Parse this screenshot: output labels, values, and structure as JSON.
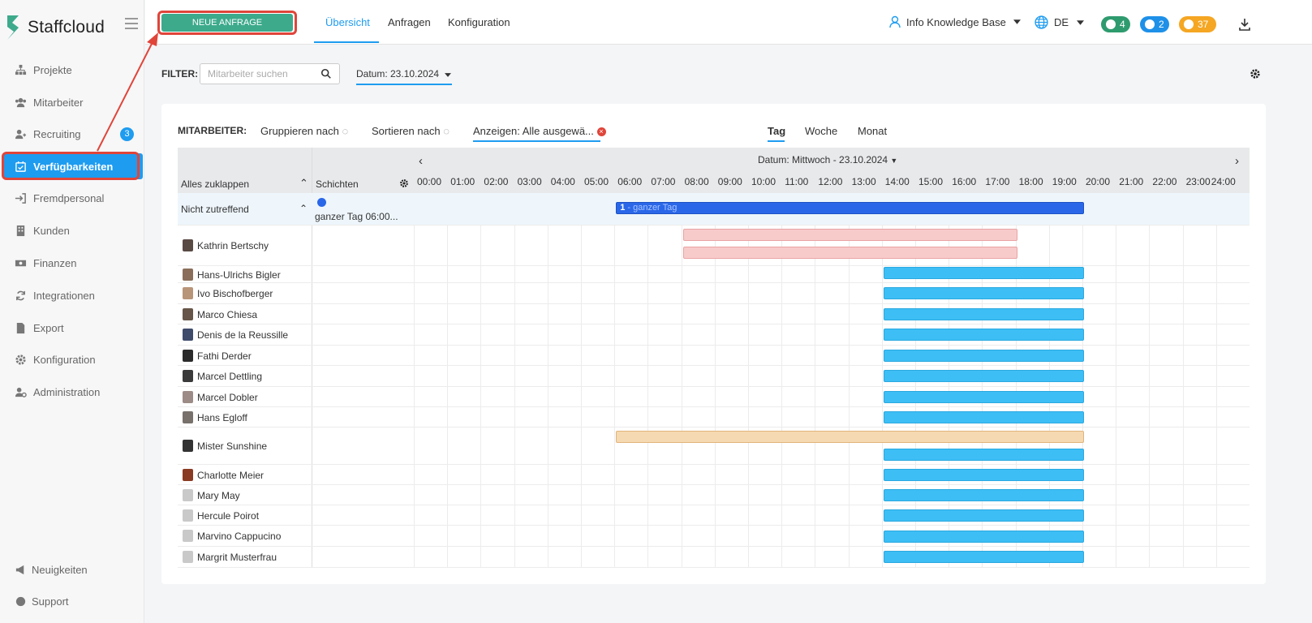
{
  "app": {
    "name": "Staffcloud"
  },
  "sidebar": {
    "items": [
      {
        "label": "Projekte",
        "icon": "sitemap-icon"
      },
      {
        "label": "Mitarbeiter",
        "icon": "users-icon"
      },
      {
        "label": "Recruiting",
        "icon": "user-plus-icon",
        "badge": "3"
      },
      {
        "label": "Verfügbarkeiten",
        "icon": "calendar-check-icon",
        "active": true
      },
      {
        "label": "Fremdpersonal",
        "icon": "sign-in-icon"
      },
      {
        "label": "Kunden",
        "icon": "building-icon"
      },
      {
        "label": "Finanzen",
        "icon": "money-icon"
      },
      {
        "label": "Integrationen",
        "icon": "sync-icon"
      },
      {
        "label": "Export",
        "icon": "file-icon"
      },
      {
        "label": "Konfiguration",
        "icon": "gear-icon"
      },
      {
        "label": "Administration",
        "icon": "user-cog-icon"
      }
    ],
    "news_label": "Neuigkeiten",
    "support_label": "Support"
  },
  "topbar": {
    "new_request_label": "NEUE ANFRAGE",
    "tabs": [
      "Übersicht",
      "Anfragen",
      "Konfiguration"
    ],
    "user_label": "Info Knowledge Base",
    "lang_label": "DE",
    "pills": [
      {
        "count": "4",
        "color": "#2e9b6e",
        "icon": "chat-icon"
      },
      {
        "count": "2",
        "color": "#1e90e8",
        "icon": "bell-icon"
      },
      {
        "count": "37",
        "color": "#f5a623",
        "icon": "clock-icon"
      }
    ]
  },
  "filter": {
    "label": "FILTER:",
    "search_placeholder": "Mitarbeiter suchen",
    "date_label": "Datum: 23.10.2024"
  },
  "controls": {
    "employees_label": "MITARBEITER:",
    "group_by": "Gruppieren nach",
    "sort_by": "Sortieren nach",
    "show": "Anzeigen: Alle ausgewä...",
    "view_tabs": [
      "Tag",
      "Woche",
      "Monat"
    ]
  },
  "grid": {
    "collapse_all": "Alles zuklappen",
    "shifts_header": "Schichten",
    "date_header": "Datum: Mittwoch - 23.10.2024",
    "hours": [
      "00:00",
      "01:00",
      "02:00",
      "03:00",
      "04:00",
      "05:00",
      "06:00",
      "07:00",
      "08:00",
      "09:00",
      "10:00",
      "11:00",
      "12:00",
      "13:00",
      "14:00",
      "15:00",
      "16:00",
      "17:00",
      "18:00",
      "19:00",
      "20:00",
      "21:00",
      "22:00",
      "23:00",
      "24:00"
    ],
    "unassigned": {
      "label": "Nicht zutreffend",
      "shift_label": "ganzer Tag 06:00...",
      "bar_count": "1",
      "bar_text": " - ganzer Tag"
    },
    "rows": [
      {
        "name": "Kathrin Bertschy"
      },
      {
        "name": "Hans-Ulrichs Bigler"
      },
      {
        "name": "Ivo Bischofberger"
      },
      {
        "name": "Marco Chiesa"
      },
      {
        "name": "Denis de la Reussille"
      },
      {
        "name": "Fathi Derder"
      },
      {
        "name": "Marcel Dettling"
      },
      {
        "name": "Marcel Dobler"
      },
      {
        "name": "Hans Egloff"
      },
      {
        "name": "Mister Sunshine"
      },
      {
        "name": "Charlotte Meier"
      },
      {
        "name": "Mary May"
      },
      {
        "name": "Hercule Poirot"
      },
      {
        "name": "Marvino Cappucino"
      },
      {
        "name": "Margrit Musterfrau"
      }
    ]
  }
}
